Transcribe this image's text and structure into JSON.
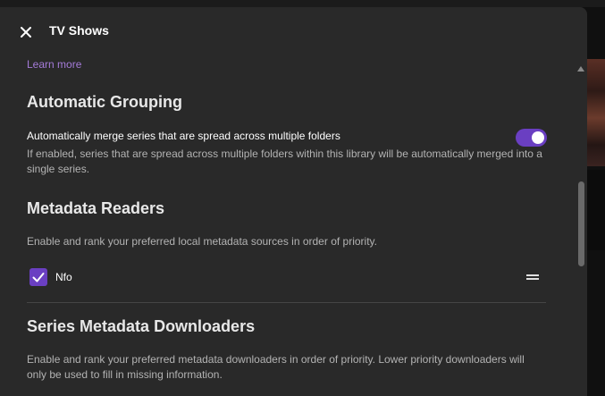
{
  "dialog": {
    "title": "TV Shows",
    "close_icon": "close-icon"
  },
  "learn_more": "Learn more",
  "grouping": {
    "heading": "Automatic Grouping",
    "toggle_label": "Automatically merge series that are spread across multiple folders",
    "toggle_on": true,
    "description": "If enabled, series that are spread across multiple folders within this library will be automatically merged into a single series."
  },
  "metadata_readers": {
    "heading": "Metadata Readers",
    "description": "Enable and rank your preferred local metadata sources in order of priority.",
    "items": [
      {
        "label": "Nfo",
        "checked": true,
        "handle_icon": "drag-handle-icon"
      }
    ]
  },
  "series_downloaders": {
    "heading": "Series Metadata Downloaders",
    "description": "Enable and rank your preferred metadata downloaders in order of priority. Lower priority downloaders will only be used to fill in missing information."
  },
  "colors": {
    "accent": "#6a3fc2",
    "link": "#a47bd8",
    "dialog_bg": "#292929"
  }
}
